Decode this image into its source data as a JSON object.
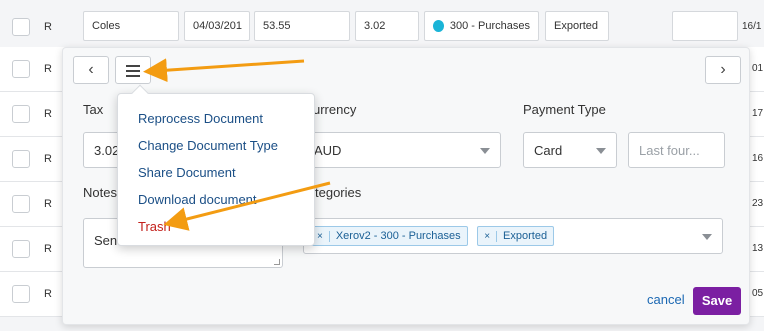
{
  "top_row": {
    "letter": "R",
    "supplier": "Coles",
    "date": "04/03/201",
    "total": "53.55",
    "tax": "3.02",
    "account": "300 - Purchases",
    "status": "Exported",
    "right_text": "16/1"
  },
  "bg_rows": [
    {
      "letter": "R",
      "right": "01"
    },
    {
      "letter": "R",
      "right": "17"
    },
    {
      "letter": "R",
      "right": "16"
    },
    {
      "letter": "R",
      "right": "23"
    },
    {
      "letter": "R",
      "right": "13"
    },
    {
      "letter": "R",
      "right": "05"
    }
  ],
  "panel": {
    "prev_icon": "chevron-left",
    "menu_icon": "hamburger",
    "next_icon": "chevron-right",
    "tax_label": "Tax",
    "tax_value": "3.02",
    "currency_label": "urrency",
    "currency_value": "AUD",
    "payment_label": "Payment Type",
    "payment_value": "Card",
    "last_four_placeholder": "Last four...",
    "notes_label": "Notes",
    "notes_value": "Sent",
    "categories_label": "tegories",
    "categories": [
      "Xerov2 - 300 - Purchases",
      "Exported"
    ],
    "cancel_label": "cancel",
    "save_label": "Save"
  },
  "menu": {
    "items": [
      "Reprocess Document",
      "Change Document Type",
      "Share Document",
      "Download document",
      "Trash"
    ]
  },
  "colors": {
    "save": "#7b1fa2",
    "trash": "#c3201b",
    "arrow": "#f39c12",
    "link": "#1b4f86"
  }
}
